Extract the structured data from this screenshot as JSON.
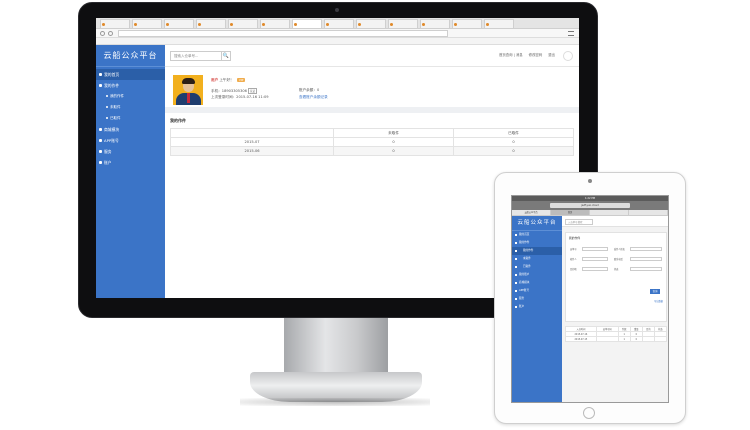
{
  "browser": {
    "tabs": [
      "",
      "",
      "",
      "",
      "",
      "",
      "",
      "",
      "",
      "",
      "",
      "",
      "",
      ""
    ],
    "address": "",
    "bookmarks": ""
  },
  "app": {
    "logo": "云船公众平台",
    "sidebar": [
      {
        "label": "我的首页",
        "active": true
      },
      {
        "label": "我的作件",
        "active": false
      },
      {
        "label": "我的作件",
        "sub": true
      },
      {
        "label": "未取件",
        "sub": true
      },
      {
        "label": "已取件",
        "sub": true
      },
      {
        "label": "商城模块"
      },
      {
        "label": "APP账号"
      },
      {
        "label": "服务"
      },
      {
        "label": "账户"
      }
    ],
    "search": {
      "placeholder": "搜索入仓单号...",
      "button": "🔍"
    },
    "toplinks": [
      "首页查询 | 消息",
      "修改密码",
      "退出"
    ],
    "profile": {
      "greeting": "上午好！",
      "name": "用户",
      "badge": "VIP",
      "phone": "手机：18903305306",
      "tag": "认证",
      "last_login": "上次登录时间：2015-07-16 11:09",
      "account_balance": "账户余额：0",
      "account_link": "查看账户余额记录"
    },
    "orders": {
      "title": "我的作件",
      "columns": [
        "",
        "未取件",
        "已取件"
      ],
      "rows": [
        [
          "2015-07",
          "0",
          "0"
        ],
        [
          "2015-06",
          "0",
          "0"
        ]
      ]
    }
  },
  "tablet": {
    "status": "1:22 PM",
    "address": "jadf.yun.cloud",
    "tabs": [
      "云船公众平台",
      "首页",
      "",
      ""
    ],
    "logo": "云船公众平台",
    "nav": [
      {
        "label": "我的首页"
      },
      {
        "label": "我的作件",
        "active": false
      },
      {
        "label": "我的作件",
        "sub": true,
        "active": true
      },
      {
        "label": "未取件",
        "sub": true
      },
      {
        "label": "已取件",
        "sub": true
      },
      {
        "label": "我的账户"
      },
      {
        "label": "商城模块"
      },
      {
        "label": "APP账号"
      },
      {
        "label": "服务"
      },
      {
        "label": "账户"
      }
    ],
    "search": "入仓单号搜索",
    "card_title": "我的作件",
    "fields": [
      "运单号",
      "发件人姓名",
      "收件人",
      "联系电话",
      "目的地",
      "状态"
    ],
    "button": "查询",
    "export": "导出数据",
    "table_head": [
      "入仓时间",
      "运单号码",
      "件数",
      "重量",
      "目的",
      "状态"
    ],
    "table_rows": [
      [
        "2015-07-16",
        "",
        "1",
        "0",
        "",
        ""
      ],
      [
        "2015-07-15",
        "",
        "1",
        "0",
        "",
        ""
      ]
    ]
  }
}
